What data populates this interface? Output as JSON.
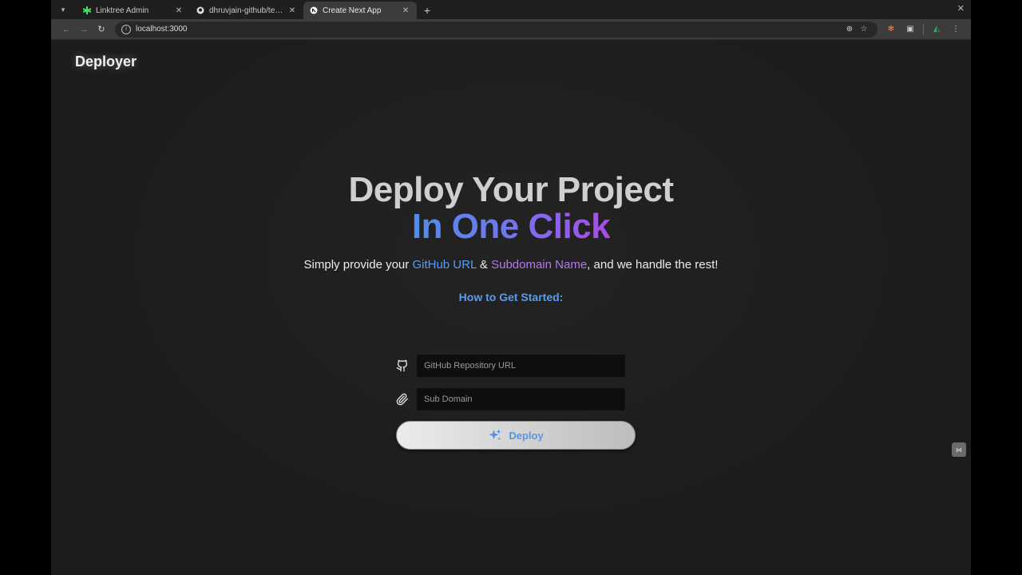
{
  "browser": {
    "tabs": [
      {
        "title": "Linktree Admin",
        "favicon": "linktree-icon",
        "active": false
      },
      {
        "title": "dhruvjain-github/temp-",
        "favicon": "github-icon",
        "active": false
      },
      {
        "title": "Create Next App",
        "favicon": "nextjs-icon",
        "active": true
      }
    ],
    "new_tab_label": "+",
    "url": "localhost:3000"
  },
  "page": {
    "brand": "Deployer",
    "headline_line1": "Deploy Your Project",
    "headline_line2": "In One Click",
    "subtitle_prefix": "Simply provide your ",
    "subtitle_github": "GitHub URL",
    "subtitle_amp": " & ",
    "subtitle_subdomain": "Subdomain Name",
    "subtitle_suffix": ", and we handle the rest!",
    "how_to_start": "How to Get Started:",
    "github_input": {
      "placeholder": "GitHub Repository URL",
      "value": "",
      "icon": "github-icon"
    },
    "subdomain_input": {
      "placeholder": "Sub Domain",
      "value": "",
      "icon": "paperclip-icon"
    },
    "deploy_label": "Deploy",
    "deploy_icon": "sparkles-icon"
  },
  "colors": {
    "accent_blue": "#5b9cf0",
    "accent_purple": "#b27be8",
    "background": "#1e1f20"
  }
}
